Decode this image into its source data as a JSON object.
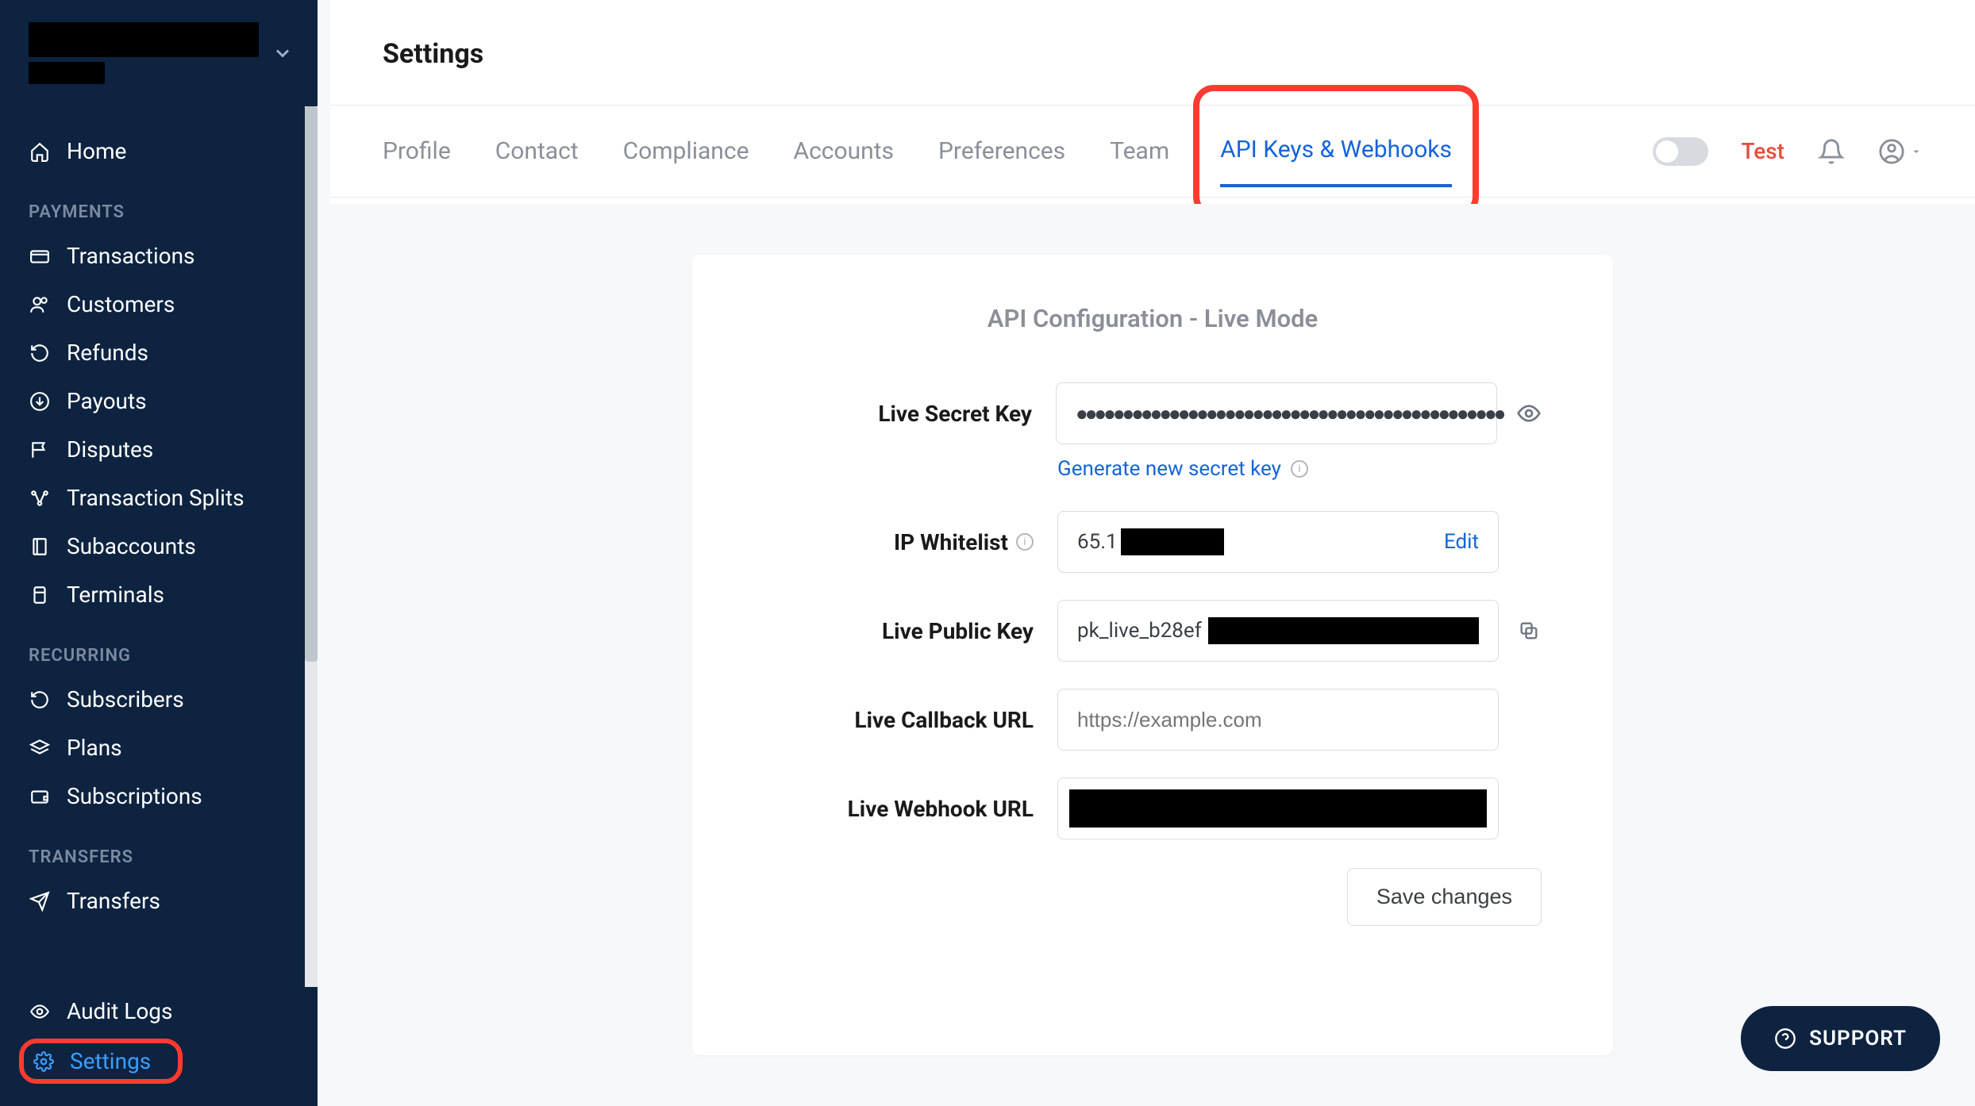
{
  "sidebar": {
    "home": "Home",
    "sections": {
      "payments": {
        "label": "PAYMENTS",
        "items": [
          "Transactions",
          "Customers",
          "Refunds",
          "Payouts",
          "Disputes",
          "Transaction Splits",
          "Subaccounts",
          "Terminals"
        ]
      },
      "recurring": {
        "label": "RECURRING",
        "items": [
          "Subscribers",
          "Plans",
          "Subscriptions"
        ]
      },
      "transfers": {
        "label": "TRANSFERS",
        "items": [
          "Transfers"
        ]
      }
    },
    "bottom": {
      "audit_logs": "Audit Logs",
      "settings": "Settings"
    }
  },
  "header": {
    "page_title": "Settings",
    "tabs": [
      "Profile",
      "Contact",
      "Compliance",
      "Accounts",
      "Preferences",
      "Team",
      "API Keys & Webhooks"
    ],
    "active_tab_index": 6,
    "test_label": "Test"
  },
  "card": {
    "title": "API Configuration - Live Mode",
    "secret_key": {
      "label": "Live Secret Key",
      "value": "●●●●●●●●●●●●●●●●●●●●●●●●●●●●●●●●●●●●●●●●●●●●●●",
      "generate_link": "Generate new secret key"
    },
    "ip_whitelist": {
      "label": "IP Whitelist",
      "value_prefix": "65.1",
      "edit": "Edit"
    },
    "public_key": {
      "label": "Live Public Key",
      "value_prefix": "pk_live_b28ef"
    },
    "callback_url": {
      "label": "Live Callback URL",
      "placeholder": "https://example.com",
      "value": ""
    },
    "webhook_url": {
      "label": "Live Webhook URL"
    },
    "save": "Save changes"
  },
  "support": "SUPPORT"
}
